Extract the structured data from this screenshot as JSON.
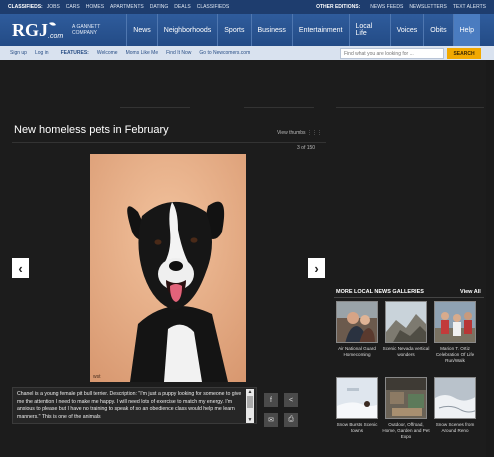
{
  "topbar": {
    "classifieds_label": "CLASSIFIEDS:",
    "classifieds_links": [
      "JOBS",
      "CARS",
      "HOMES",
      "APARTMENTS",
      "DATING",
      "DEALS",
      "CLASSIFIEDS"
    ],
    "other_label": "OTHER EDITIONS:",
    "other_links": [
      "NEWS FEEDS",
      "NEWSLETTERS",
      "TEXT ALERTS"
    ]
  },
  "header": {
    "logo_text": "RGJ.com",
    "tagline": "A GANNETT COMPANY",
    "nav": [
      "News",
      "Neighborhoods",
      "Sports",
      "Business",
      "Entertainment",
      "Local Life",
      "Voices",
      "Obits",
      "Help"
    ],
    "active_nav": "Help"
  },
  "subbar": {
    "sign_up": "Sign up",
    "log_in": "Log in",
    "features_label": "FEATURES:",
    "features": [
      "Welcome",
      "Moms Like Me",
      "Find It Now",
      "Go to Newcomers.com"
    ],
    "search_placeholder": "Find what you are looking for ...",
    "search_button": "SEARCH"
  },
  "gallery": {
    "title": "New homeless pets in February",
    "view_thumbs": "View thumbs",
    "counter": "3 of 150",
    "photo_alt": "Black and white pit bull terrier",
    "caption": "Chanel is a young female pit bull terrier. Description: \"I'm just a puppy looking for someone to give me the attention I need to make me happy. I will need lots of exercise to match my energy. I'm anxious to please but I have no training to speak of so an obedience class would help me learn manners.\" This is one of the animals",
    "photo_credit": "wst"
  },
  "more_galleries": {
    "title": "MORE LOCAL NEWS GALLERIES",
    "view_all": "View All",
    "items": [
      {
        "caption": "Air National Guard Homecoming"
      },
      {
        "caption": "Scenic Nevada vertical wonders"
      },
      {
        "caption": "Marion T. Ortiz Celebration Of Life Run/Walk"
      },
      {
        "caption": "Snow Bursts Scenic towns"
      },
      {
        "caption": "Outdoor, Offroad, Home, Garden and Pet Expo"
      },
      {
        "caption": "Snow Scenes from Around Reno"
      }
    ]
  },
  "colors": {
    "brand_blue": "#2f5c9c",
    "search_button": "#f2a900",
    "background": "#1c1c1c"
  }
}
